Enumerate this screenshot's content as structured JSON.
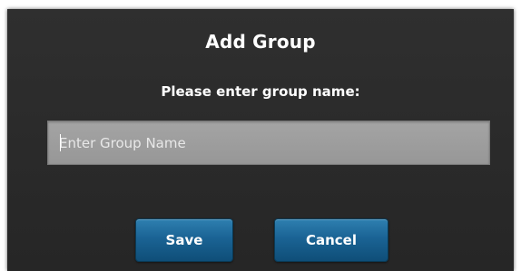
{
  "dialog": {
    "title": "Add Group",
    "prompt": "Please enter group name:",
    "group_name": {
      "value": "",
      "placeholder": "Enter Group Name"
    },
    "save_label": "Save",
    "cancel_label": "Cancel"
  },
  "colors": {
    "dialog_background": "#2b2b2b",
    "input_background": "#9d9d9d",
    "button_accent": "#1a6394",
    "text": "#ffffff"
  }
}
